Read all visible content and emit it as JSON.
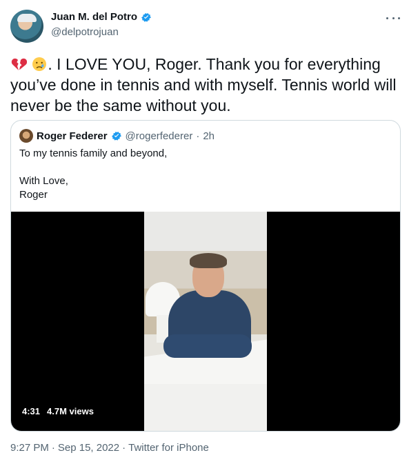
{
  "author": {
    "name": "Juan M. del Potro",
    "handle": "@delpotrojuan",
    "avatar": "user-avatar"
  },
  "icons": {
    "verified": "verified-badge-icon",
    "more": "more-icon",
    "broken_heart": "broken-heart-emoji",
    "crying_face": "crying-face-emoji"
  },
  "tweet": {
    "text": ". I LOVE YOU, Roger. Thank you for everything you’ve done in tennis and with myself. Tennis world will never be the same without you."
  },
  "quote": {
    "name": "Roger Federer",
    "handle": "@rogerfederer",
    "separator": "·",
    "time": "2h",
    "lines": [
      "To my tennis family and beyond,",
      "",
      "With Love,",
      "Roger"
    ],
    "duration": "4:31",
    "views": "4.7M views"
  },
  "footer": {
    "time": "9:27 PM",
    "date": "Sep 15, 2022",
    "source": "Twitter for iPhone"
  },
  "colors": {
    "primary_text": "#0f1419",
    "secondary_text": "#536471",
    "verified": "#1d9bf0",
    "border": "#cfd9de"
  }
}
